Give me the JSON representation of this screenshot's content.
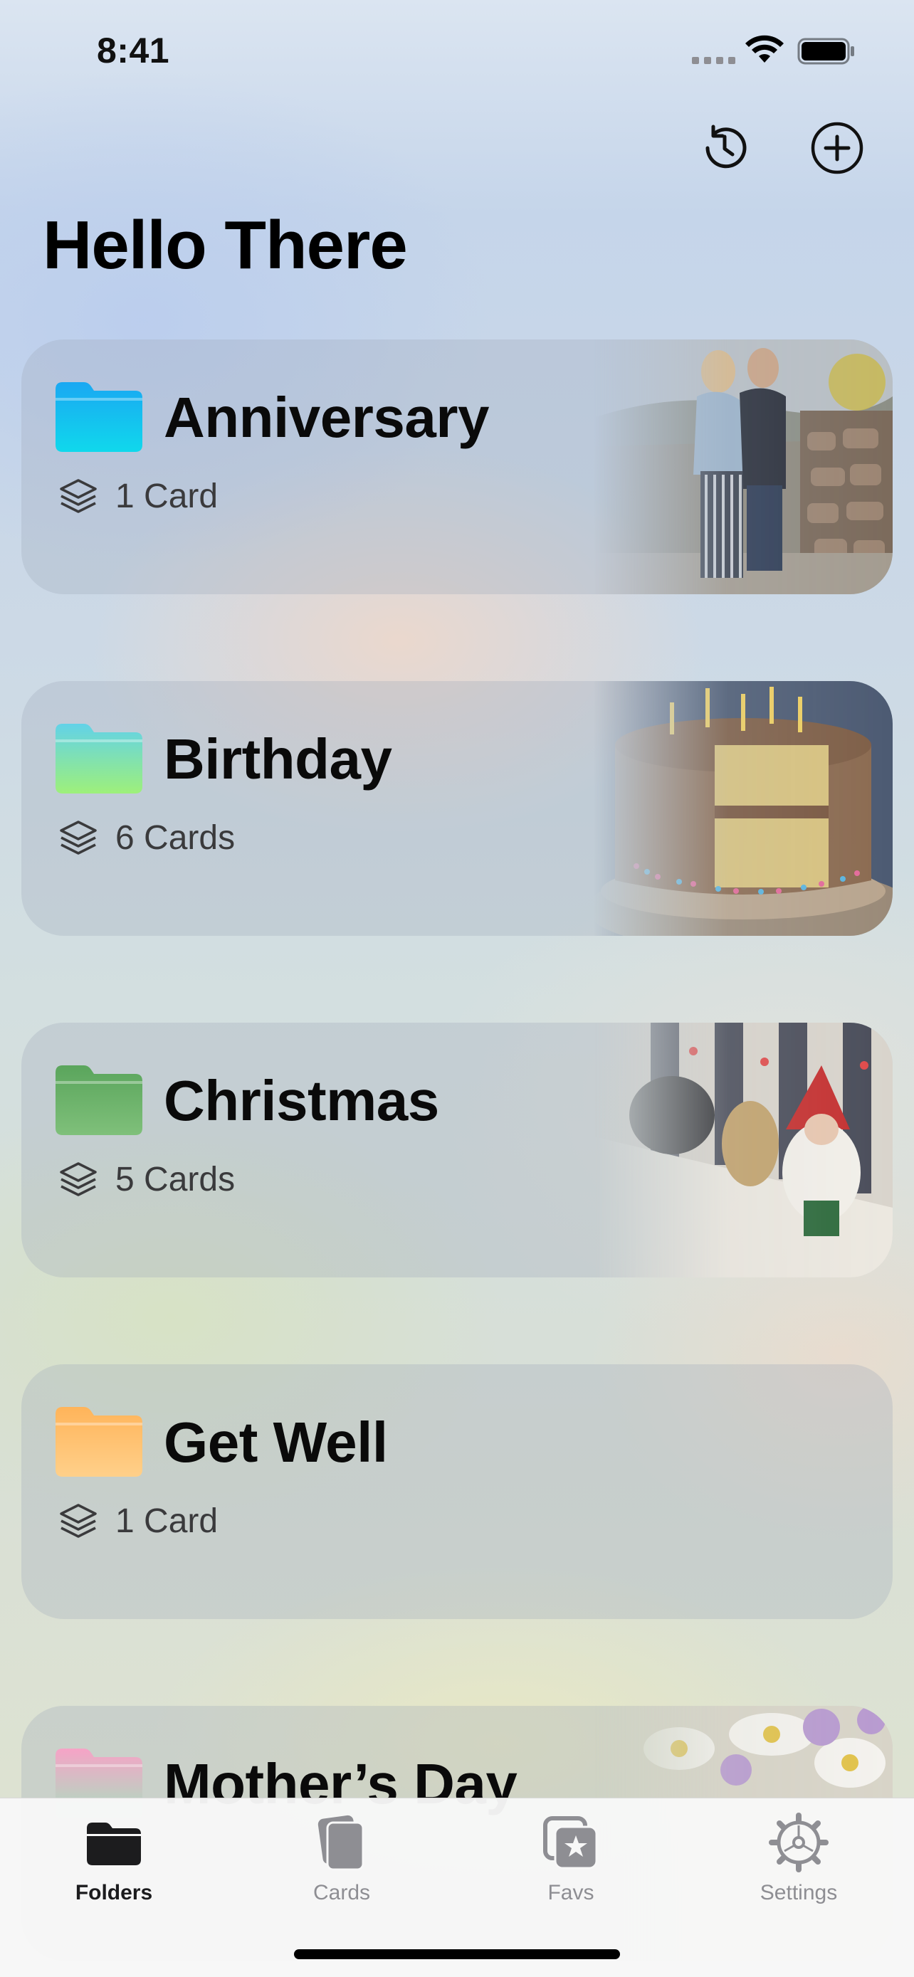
{
  "status_bar": {
    "time": "8:41"
  },
  "header": {
    "title": "Hello There",
    "actions": [
      {
        "icon": "history-icon"
      },
      {
        "icon": "plus-circle-icon"
      }
    ]
  },
  "folders": [
    {
      "name": "Anniversary",
      "count": "1 Card",
      "icon_color": "#0fc8f0",
      "photo": "couple-photo"
    },
    {
      "name": "Birthday",
      "count": "6 Cards",
      "icon_color": "#7ce08a",
      "photo": "cake-photo"
    },
    {
      "name": "Christmas",
      "count": "5 Cards",
      "icon_color": "#6ab46a",
      "photo": "christmas-decor-photo"
    },
    {
      "name": "Get Well",
      "count": "1 Card",
      "icon_color": "#ffc47a",
      "photo": ""
    },
    {
      "name": "Mother’s Day",
      "count": "",
      "icon_color": "#f6a3c6",
      "photo": "flowers-photo"
    }
  ],
  "tab_bar": {
    "tabs": [
      {
        "label": "Folders",
        "icon": "folder-icon",
        "active": true
      },
      {
        "label": "Cards",
        "icon": "cards-icon",
        "active": false
      },
      {
        "label": "Favs",
        "icon": "favs-star-icon",
        "active": false
      },
      {
        "label": "Settings",
        "icon": "gear-icon",
        "active": false
      }
    ]
  }
}
